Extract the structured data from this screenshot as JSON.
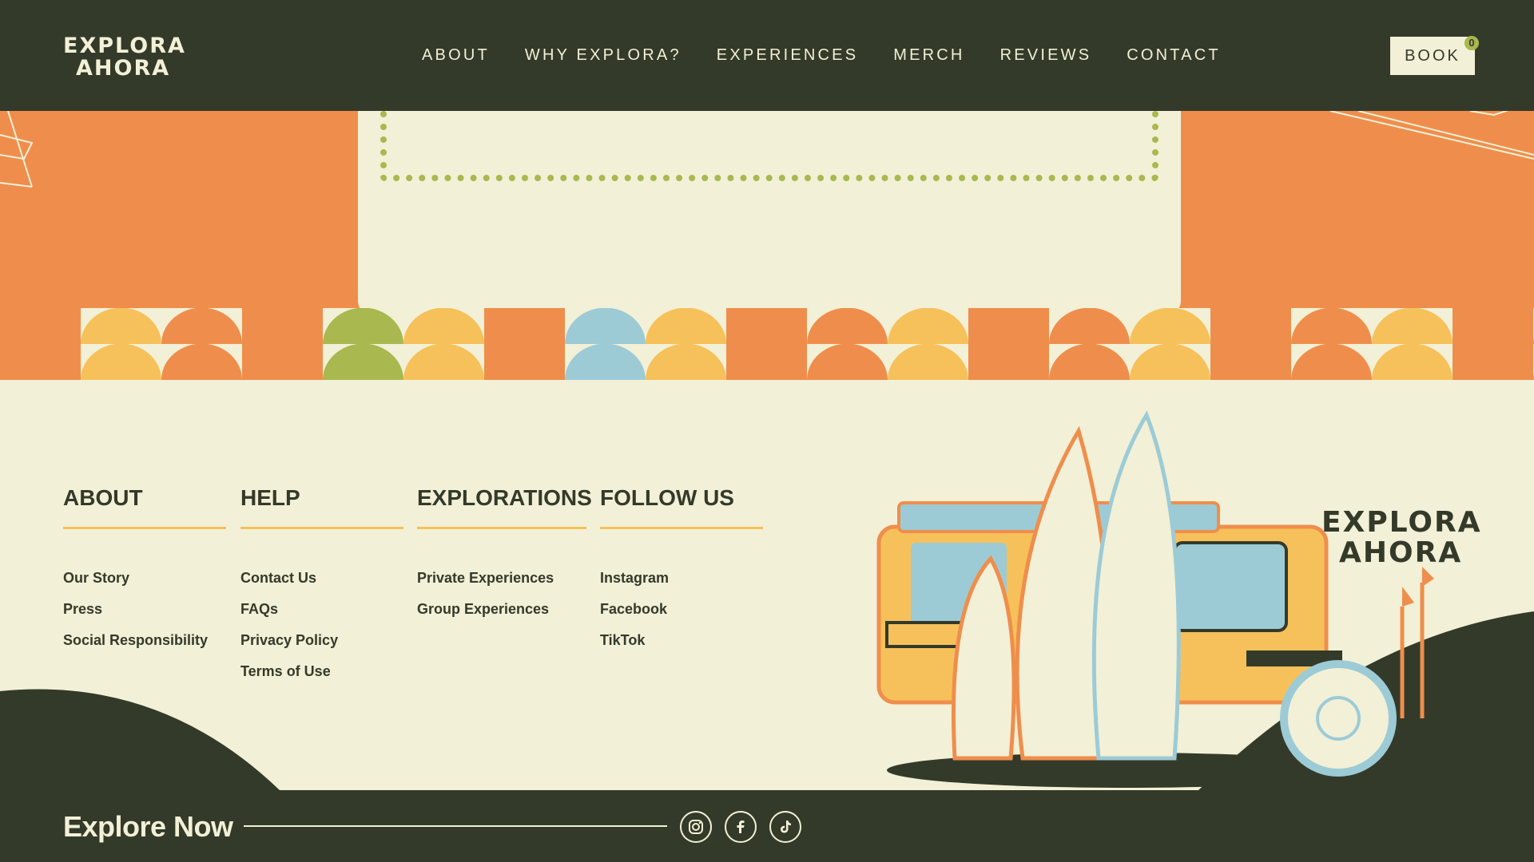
{
  "header": {
    "logo_line1": "EXPLORA",
    "logo_line2": "AHORA",
    "nav": [
      "ABOUT",
      "WHY EXPLORA?",
      "EXPERIENCES",
      "MERCH",
      "REVIEWS",
      "CONTACT"
    ],
    "book_label": "BOOK",
    "cart_count": "0"
  },
  "footer": {
    "columns": [
      {
        "title": "ABOUT",
        "items": [
          "Our Story",
          "Press",
          "Social Responsibility"
        ]
      },
      {
        "title": "HELP",
        "items": [
          "Contact Us",
          "FAQs",
          "Privacy Policy",
          "Terms of Use"
        ]
      },
      {
        "title": "EXPLORATIONS",
        "items": [
          "Private Experiences",
          "Group Experiences"
        ]
      },
      {
        "title": "FOLLOW US",
        "items": [
          "Instagram",
          "Facebook",
          "TikTok"
        ]
      }
    ],
    "logo_line1": "EXPLORA",
    "logo_line2": "AHORA",
    "explore_label": "Explore Now",
    "social_icons": [
      "instagram-icon",
      "facebook-icon",
      "tiktok-icon"
    ]
  },
  "colors": {
    "dark": "#343a2a",
    "cream": "#f2f0d6",
    "orange": "#ef8e4c",
    "yellow": "#f6c15a",
    "green": "#a9b84f",
    "blue": "#9ccbd6"
  }
}
